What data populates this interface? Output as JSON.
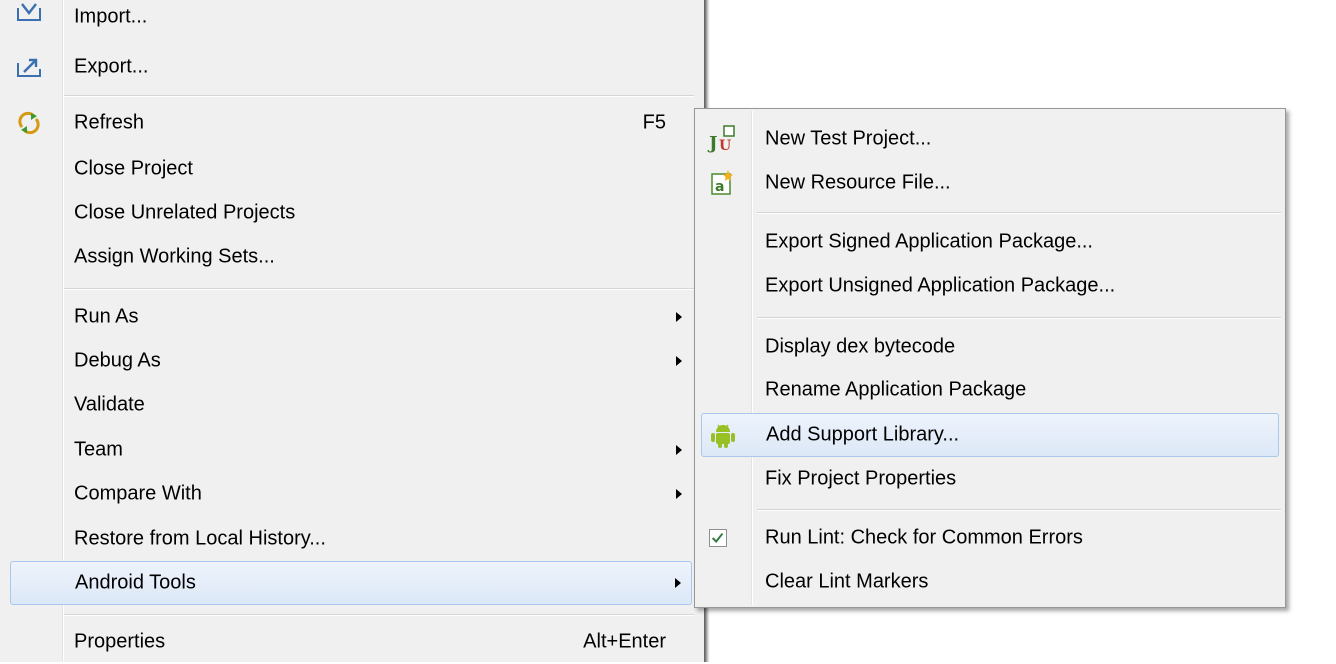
{
  "main_menu": {
    "items": [
      {
        "label": "Import...",
        "icon": "import-icon"
      },
      {
        "label": "Export...",
        "icon": "export-icon"
      },
      {
        "label": "Refresh",
        "shortcut": "F5",
        "icon": "refresh-icon"
      },
      {
        "label": "Close Project"
      },
      {
        "label": "Close Unrelated Projects"
      },
      {
        "label": "Assign Working Sets..."
      },
      {
        "label": "Run As",
        "submenu": true
      },
      {
        "label": "Debug As",
        "submenu": true
      },
      {
        "label": "Validate"
      },
      {
        "label": "Team",
        "submenu": true
      },
      {
        "label": "Compare With",
        "submenu": true
      },
      {
        "label": "Restore from Local History..."
      },
      {
        "label": "Android Tools",
        "submenu": true,
        "highlighted": true
      },
      {
        "label": "Properties",
        "shortcut": "Alt+Enter"
      }
    ]
  },
  "submenu": {
    "items": [
      {
        "label": "New Test Project...",
        "icon": "junit-test-project-icon"
      },
      {
        "label": "New Resource File...",
        "icon": "android-resource-file-icon"
      },
      {
        "label": "Export Signed Application Package..."
      },
      {
        "label": "Export Unsigned Application Package..."
      },
      {
        "label": "Display dex bytecode"
      },
      {
        "label": "Rename Application Package"
      },
      {
        "label": "Add Support Library...",
        "icon": "android-robot-icon",
        "highlighted": true
      },
      {
        "label": "Fix Project Properties"
      },
      {
        "label": "Run Lint: Check for Common Errors",
        "icon": "checkbox-checked-icon"
      },
      {
        "label": "Clear Lint Markers"
      }
    ]
  },
  "colors": {
    "menu_bg": "#f0f0f0",
    "highlight_border": "#a8c8ec",
    "highlight_fill": "#dce8f7",
    "android_green": "#97c024"
  }
}
